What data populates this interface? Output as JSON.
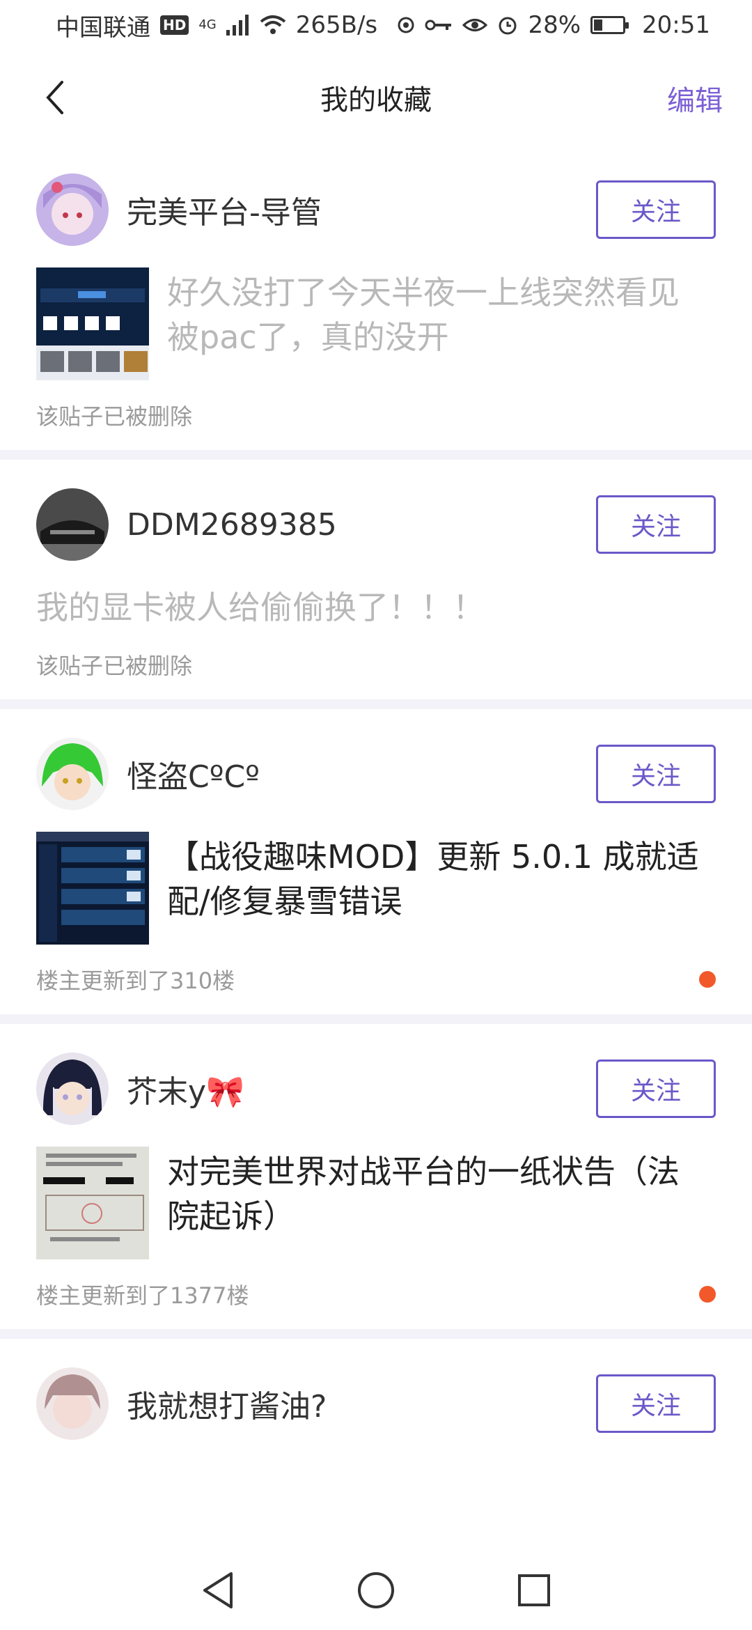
{
  "status_bar": {
    "carrier": "中国联通",
    "hd": "HD",
    "network": "4G",
    "speed": "265B/s",
    "battery": "28%",
    "time": "20:51"
  },
  "header": {
    "title": "我的收藏",
    "edit_label": "编辑"
  },
  "follow_label": "关注",
  "posts": [
    {
      "username": "完美平台-导管",
      "text": "好久没打了今天半夜一上线突然看见被pac了，真的没开",
      "footer": "该贴子已被删除"
    },
    {
      "username": "DDM2689385",
      "text": "我的显卡被人给偷偷换了！！！",
      "footer": "该贴子已被删除"
    },
    {
      "username": "怪盗CºCº",
      "text": "【战役趣味MOD】更新 5.0.1 成就适配/修复暴雪错误",
      "footer": "楼主更新到了310楼"
    },
    {
      "username": "芥末y🎀",
      "text": "对完美世界对战平台的一纸状告（法院起诉）",
      "footer": "楼主更新到了1377楼"
    },
    {
      "username": "我就想打酱油?"
    }
  ],
  "colors": {
    "accent": "#6b58c9",
    "unread_dot": "#f2592a",
    "deleted_text": "#b8b8b8"
  }
}
